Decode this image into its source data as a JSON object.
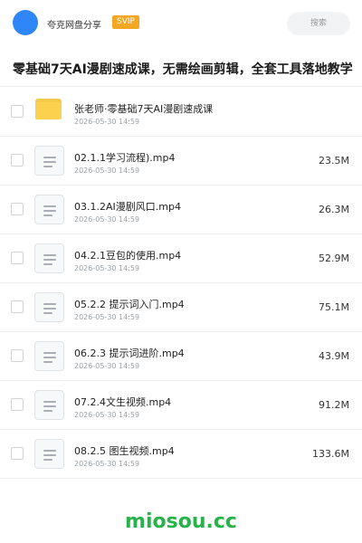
{
  "header": {
    "app_name": "夸克网盘分享",
    "badge": "SVIP",
    "search_placeholder": "搜索"
  },
  "title": "零基础7天AI漫剧速成课，无需绘画剪辑，全套工具落地教学",
  "files": [
    {
      "name": "张老师·零基础7天AI漫剧速成课",
      "date": "2026-05-30 14:59",
      "size": "",
      "type": "folder"
    },
    {
      "name": "02.1.1学习流程).mp4",
      "date": "2026-05-30 14:59",
      "size": "23.5M",
      "type": "video"
    },
    {
      "name": "03.1.2AI漫剧风口.mp4",
      "date": "2026-05-30 14:59",
      "size": "26.3M",
      "type": "video"
    },
    {
      "name": "04.2.1豆包的使用.mp4",
      "date": "2026-05-30 14:59",
      "size": "52.9M",
      "type": "video"
    },
    {
      "name": "05.2.2 提示词入门.mp4",
      "date": "2026-05-30 14:59",
      "size": "75.1M",
      "type": "video"
    },
    {
      "name": "06.2.3 提示词进阶.mp4",
      "date": "2026-05-30 14:59",
      "size": "43.9M",
      "type": "video"
    },
    {
      "name": "07.2.4文生视频.mp4",
      "date": "2026-05-30 14:59",
      "size": "91.2M",
      "type": "video"
    },
    {
      "name": "08.2.5 图生视频.mp4",
      "date": "2026-05-30 14:59",
      "size": "133.6M",
      "type": "video"
    }
  ],
  "watermark": "miosou.cc",
  "colors": {
    "avatar": "#2f86f6",
    "badge": "#f5a623",
    "folder": "#fbd24e",
    "watermark": "#27b34a"
  },
  "icons": {
    "folder": "folder-icon",
    "video": "document-lines-icon",
    "checkbox": "checkbox-icon"
  }
}
